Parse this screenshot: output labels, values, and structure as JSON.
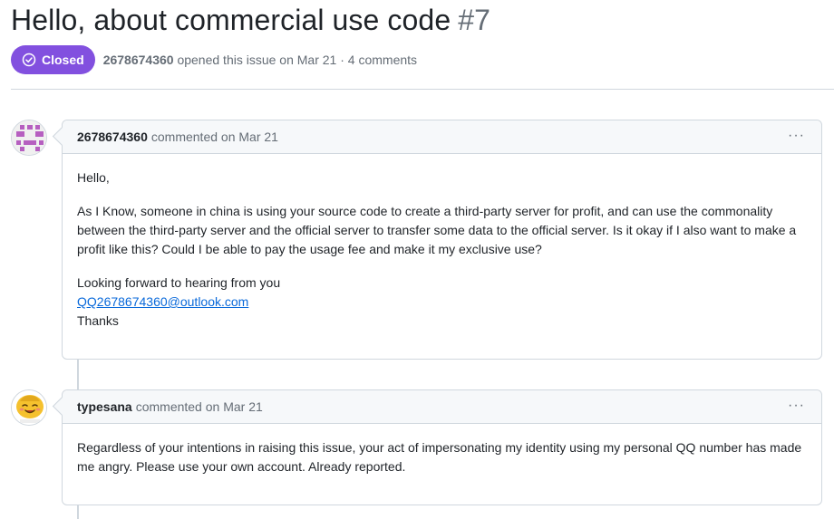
{
  "issue": {
    "title": "Hello, about commercial use code",
    "number": "#7",
    "state": "Closed",
    "meta_author": "2678674360",
    "meta_text": "opened this issue on Mar 21 · 4 comments"
  },
  "comments": [
    {
      "author": "2678674360",
      "action": "commented on Mar 21",
      "kebab": "···",
      "paragraphs": [
        "Hello,",
        "As I Know, someone in china is using your source code to create a third-party server for profit, and can use the commonality between the third-party server and the official server to transfer some data to the official server. Is it okay if I also want to make a profit like this? Could I be able to pay the usage fee and make it my exclusive use?",
        "Looking forward to hearing from you"
      ],
      "email": "QQ2678674360@outlook.com",
      "closing": "Thanks"
    },
    {
      "author": "typesana",
      "action": "commented on Mar 21",
      "kebab": "···",
      "paragraphs": [
        "Regardless of your intentions in raising this issue, your act of impersonating my identity using my personal QQ number has made me angry. Please use your own account. Already reported."
      ]
    }
  ],
  "colors": {
    "closed_badge": "#8250df",
    "link": "#0969da",
    "identicon": "#b65fc0",
    "emoji_face": "#f5c12e"
  },
  "icons": {
    "state": "check-circle-icon",
    "menu": "kebab-horizontal-icon"
  }
}
